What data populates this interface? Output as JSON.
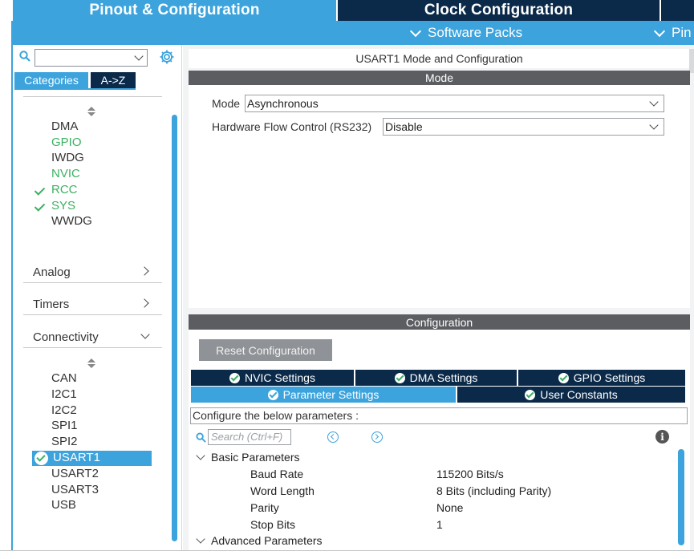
{
  "top_tabs": {
    "pinout": "Pinout & Configuration",
    "clock": "Clock Configuration",
    "software_packs": "Software Packs",
    "pinout_short": "Pin"
  },
  "left": {
    "tabs": {
      "categories": "Categories",
      "az": "A->Z"
    },
    "system_items": [
      {
        "label": "DMA",
        "color": "default",
        "checked": false
      },
      {
        "label": "GPIO",
        "color": "green",
        "checked": false
      },
      {
        "label": "IWDG",
        "color": "default",
        "checked": false
      },
      {
        "label": "NVIC",
        "color": "green",
        "checked": false
      },
      {
        "label": "RCC",
        "color": "green",
        "checked": true
      },
      {
        "label": "SYS",
        "color": "green",
        "checked": true
      },
      {
        "label": "WWDG",
        "color": "default",
        "checked": false
      }
    ],
    "groups": {
      "analog": "Analog",
      "timers": "Timers",
      "connectivity": "Connectivity"
    },
    "connectivity_items": [
      "CAN",
      "I2C1",
      "I2C2",
      "SPI1",
      "SPI2",
      "USART1",
      "USART2",
      "USART3",
      "USB"
    ],
    "selected": "USART1"
  },
  "mode_section": {
    "title": "USART1 Mode and Configuration",
    "header": "Mode",
    "mode_label": "Mode",
    "mode_value": "Asynchronous",
    "flow_label": "Hardware Flow Control (RS232)",
    "flow_value": "Disable"
  },
  "config_section": {
    "header": "Configuration",
    "reset_button": "Reset Configuration",
    "tabs": {
      "nvic": "NVIC Settings",
      "dma": "DMA Settings",
      "gpio": "GPIO Settings",
      "params": "Parameter Settings",
      "user_constants": "User Constants"
    },
    "info": "Configure the below parameters :",
    "search_placeholder": "Search (Ctrl+F)",
    "basic_group": "Basic Parameters",
    "advanced_group": "Advanced Parameters",
    "params": [
      {
        "name": "Baud Rate",
        "value": "115200 Bits/s"
      },
      {
        "name": "Word Length",
        "value": "8 Bits (including Parity)"
      },
      {
        "name": "Parity",
        "value": "None"
      },
      {
        "name": "Stop Bits",
        "value": "1"
      }
    ]
  },
  "colors": {
    "accent": "#3ca3dc",
    "navy": "#0b2a4a",
    "enabled_green": "#3cb062",
    "header_gray": "#5b5d60"
  }
}
